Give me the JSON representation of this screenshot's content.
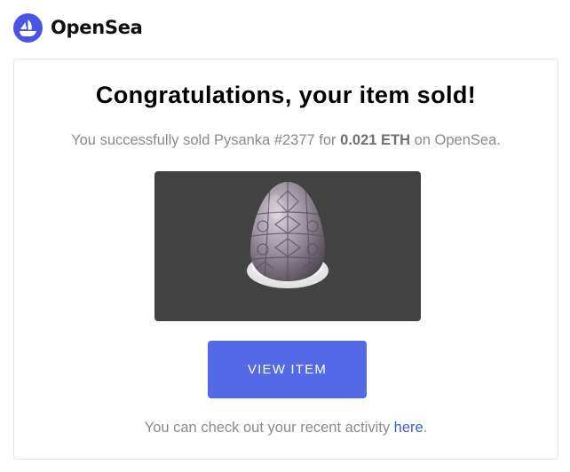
{
  "brand": {
    "name": "OpenSea",
    "logo_icon": "opensea-logo-icon",
    "accent_color": "#2081e2"
  },
  "card": {
    "title": "Congratulations, your item sold!",
    "message": {
      "prefix": "You successfully sold Pysanka #2377 for ",
      "amount": "0.021 ETH",
      "suffix": " on OpenSea."
    },
    "nft_image": "pysanka-egg-image",
    "button_label": "VIEW ITEM",
    "button_color": "#5469e8",
    "footer": {
      "prefix": "You can check out your recent activity ",
      "link_text": "here",
      "suffix": "."
    }
  }
}
